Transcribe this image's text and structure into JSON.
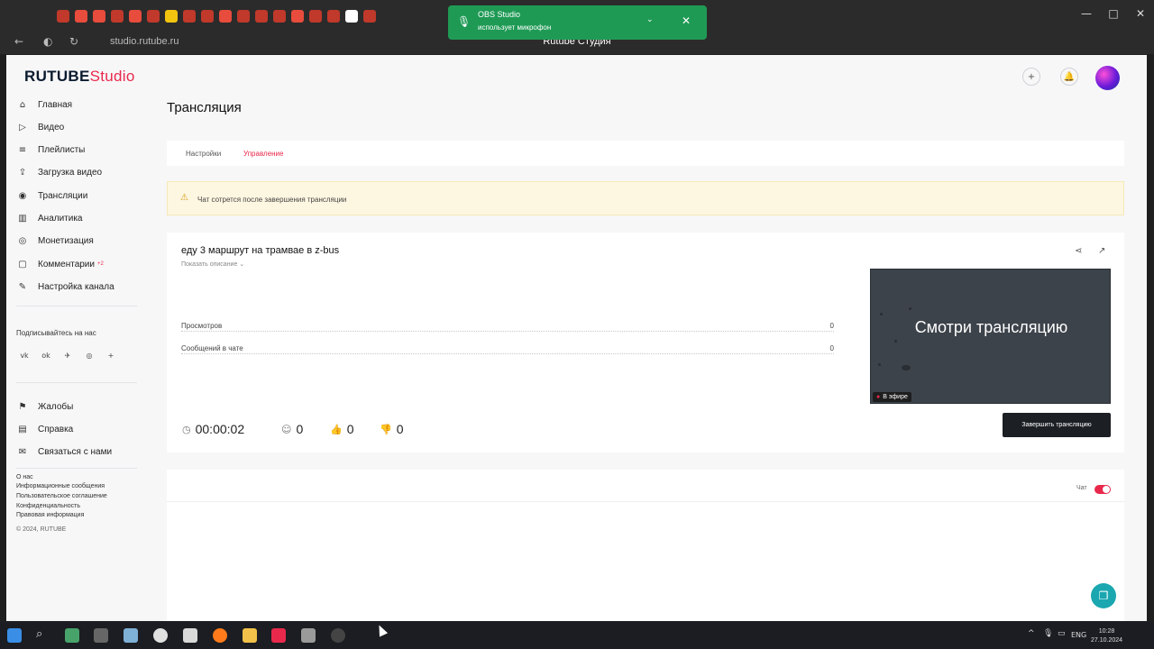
{
  "browser": {
    "url": "studio.rutube.ru",
    "page_title": "Rutube Студия",
    "tab_icon_colors": [
      "#c0392b",
      "#e74c3c",
      "#e74c3c",
      "#c0392b",
      "#e74c3c",
      "#c0392b",
      "#f1c40f",
      "#c0392b",
      "#c0392b",
      "#e74c3c",
      "#c0392b",
      "#c0392b",
      "#c0392b",
      "#e74c3c",
      "#c0392b",
      "#c0392b",
      "#ffffff",
      "#c0392b"
    ]
  },
  "notification": {
    "app": "OBS Studio",
    "message": "использует микрофон"
  },
  "brand": {
    "name": "RUTUBE",
    "suffix": "Studio",
    "accent": "#e8294c"
  },
  "sidebar": {
    "items": [
      {
        "label": "Главная",
        "icon": "home-icon"
      },
      {
        "label": "Видео",
        "icon": "video-icon"
      },
      {
        "label": "Плейлисты",
        "icon": "playlist-icon"
      },
      {
        "label": "Загрузка видео",
        "icon": "upload-icon"
      },
      {
        "label": "Трансляции",
        "icon": "broadcast-icon"
      },
      {
        "label": "Аналитика",
        "icon": "analytics-icon"
      },
      {
        "label": "Монетизация",
        "icon": "monetization-icon"
      },
      {
        "label": "Комментарии",
        "icon": "comments-icon",
        "badge": "+2"
      },
      {
        "label": "Настройка канала",
        "icon": "settings-icon"
      }
    ],
    "subscribe_label": "Подписывайтесь на нас",
    "secondary": [
      {
        "label": "Жалобы",
        "icon": "flag-icon"
      },
      {
        "label": "Справка",
        "icon": "book-icon"
      },
      {
        "label": "Связаться с нами",
        "icon": "mail-icon"
      }
    ],
    "footer": {
      "about": "О нас",
      "info": "Информационные сообщения",
      "agreement": "Пользовательское соглашение",
      "privacy": "Конфиденциальность",
      "legal": "Правовая информация",
      "copyright": "© 2024, RUTUBE"
    }
  },
  "main": {
    "title": "Трансляция",
    "tabs": [
      {
        "label": "Настройки"
      },
      {
        "label": "Управление"
      }
    ],
    "warning": "Чат сотрется после завершения трансляции",
    "stream": {
      "title": "еду 3 маршрут на трамвае в z-bus",
      "show_description": "Показать описание",
      "views_label": "Просмотров",
      "views_value": "0",
      "chat_messages_label": "Сообщений в чате",
      "chat_messages_value": "0",
      "duration": "00:00:02",
      "viewers": "0",
      "likes": "0",
      "dislikes": "0",
      "preview_text": "Смотри трансляцию",
      "live_label": "В эфире",
      "end_button": "Завершить трансляцию"
    },
    "chat": {
      "label": "Чат",
      "enabled": true
    }
  },
  "taskbar": {
    "lang": "ENG",
    "time": "10:28",
    "date": "27.10.2024"
  }
}
